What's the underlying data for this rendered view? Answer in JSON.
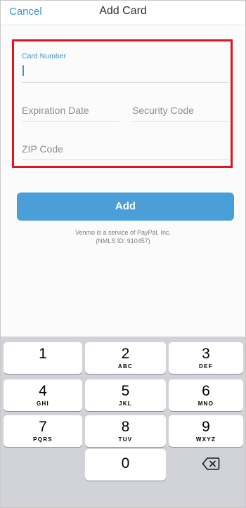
{
  "header": {
    "cancel_label": "Cancel",
    "title": "Add Card"
  },
  "form": {
    "card_number_label": "Card Number",
    "card_number_value": "",
    "expiration_placeholder": "Expiration Date",
    "security_placeholder": "Security Code",
    "zip_placeholder": "ZIP Code"
  },
  "add_button_label": "Add",
  "footer": {
    "line1": "Venmo is a service of PayPal, Inc.",
    "line2": "(NMLS ID: 910457)"
  },
  "keypad": {
    "keys": [
      {
        "digit": "1",
        "letters": ""
      },
      {
        "digit": "2",
        "letters": "ABC"
      },
      {
        "digit": "3",
        "letters": "DEF"
      },
      {
        "digit": "4",
        "letters": "GHI"
      },
      {
        "digit": "5",
        "letters": "JKL"
      },
      {
        "digit": "6",
        "letters": "MNO"
      },
      {
        "digit": "7",
        "letters": "PQRS"
      },
      {
        "digit": "8",
        "letters": "TUV"
      },
      {
        "digit": "9",
        "letters": "WXYZ"
      },
      {
        "digit": "0",
        "letters": ""
      }
    ],
    "backspace_icon": "backspace-icon"
  },
  "colors": {
    "accent": "#3d95ce",
    "button": "#4a9fd8",
    "highlight": "#e0141c",
    "keypad_bg": "#d1d3d9"
  }
}
